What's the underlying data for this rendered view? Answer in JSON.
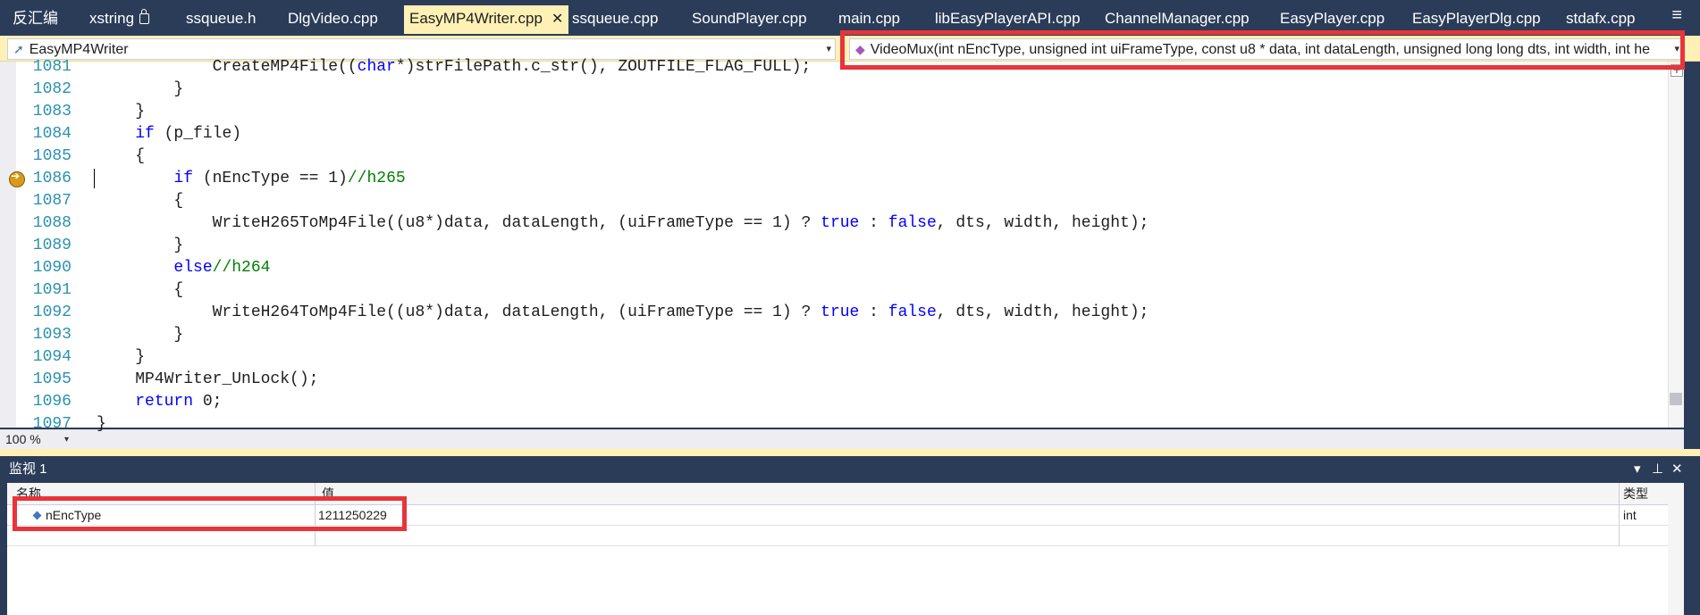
{
  "tabs": [
    {
      "label": "反汇编",
      "active": false
    },
    {
      "label": "xstring",
      "active": false,
      "locked": true
    },
    {
      "label": "ssqueue.h",
      "active": false
    },
    {
      "label": "DlgVideo.cpp",
      "active": false
    },
    {
      "label": "EasyMP4Writer.cpp",
      "active": true,
      "close": "✕"
    },
    {
      "label": "ssqueue.cpp",
      "active": false
    },
    {
      "label": "SoundPlayer.cpp",
      "active": false
    },
    {
      "label": "main.cpp",
      "active": false
    },
    {
      "label": "libEasyPlayerAPI.cpp",
      "active": false
    },
    {
      "label": "ChannelManager.cpp",
      "active": false
    },
    {
      "label": "EasyPlayer.cpp",
      "active": false
    },
    {
      "label": "EasyPlayerDlg.cpp",
      "active": false
    },
    {
      "label": "stdafx.cpp",
      "active": false
    }
  ],
  "nav": {
    "scope": "EasyMP4Writer",
    "member": "VideoMux(int nEncType, unsigned int uiFrameType, const u8 * data, int dataLength, unsigned long long dts, int width, int he"
  },
  "code_lines": [
    {
      "num": "1081",
      "segs": [
        {
          "t": "            CreateMP4File(("
        },
        {
          "t": "char",
          "c": "kw"
        },
        {
          "t": "*)strFilePath.c_str(), ZOUTFILE_FLAG_FULL);"
        }
      ]
    },
    {
      "num": "1082",
      "segs": [
        {
          "t": "        }"
        }
      ]
    },
    {
      "num": "1083",
      "segs": [
        {
          "t": "    }"
        }
      ]
    },
    {
      "num": "1084",
      "segs": [
        {
          "t": "    "
        },
        {
          "t": "if",
          "c": "kw"
        },
        {
          "t": " (p_file)"
        }
      ]
    },
    {
      "num": "1085",
      "segs": [
        {
          "t": "    {"
        }
      ]
    },
    {
      "num": "1086",
      "segs": [
        {
          "t": "        "
        },
        {
          "t": "if",
          "c": "kw"
        },
        {
          "t": " (nEncType == 1)"
        },
        {
          "t": "//h265",
          "c": "cm"
        }
      ]
    },
    {
      "num": "1087",
      "segs": [
        {
          "t": "        {"
        }
      ]
    },
    {
      "num": "1088",
      "segs": [
        {
          "t": "            WriteH265ToMp4File((u8*)data, dataLength, (uiFrameType == 1) ? "
        },
        {
          "t": "true",
          "c": "kw"
        },
        {
          "t": " : "
        },
        {
          "t": "false",
          "c": "kw"
        },
        {
          "t": ", dts, width, height);"
        }
      ]
    },
    {
      "num": "1089",
      "segs": [
        {
          "t": "        }"
        }
      ]
    },
    {
      "num": "1090",
      "segs": [
        {
          "t": "        "
        },
        {
          "t": "else",
          "c": "kw"
        },
        {
          "t": "//h264",
          "c": "cm"
        }
      ]
    },
    {
      "num": "1091",
      "segs": [
        {
          "t": "        {"
        }
      ]
    },
    {
      "num": "1092",
      "segs": [
        {
          "t": "            WriteH264ToMp4File((u8*)data, dataLength, (uiFrameType == 1) ? "
        },
        {
          "t": "true",
          "c": "kw"
        },
        {
          "t": " : "
        },
        {
          "t": "false",
          "c": "kw"
        },
        {
          "t": ", dts, width, height);"
        }
      ]
    },
    {
      "num": "1093",
      "segs": [
        {
          "t": "        }"
        }
      ]
    },
    {
      "num": "1094",
      "segs": [
        {
          "t": "    }"
        }
      ]
    },
    {
      "num": "1095",
      "segs": [
        {
          "t": "    MP4Writer_UnLock();"
        }
      ]
    },
    {
      "num": "1096",
      "segs": [
        {
          "t": "    "
        },
        {
          "t": "return",
          "c": "kw"
        },
        {
          "t": " 0;"
        }
      ]
    },
    {
      "num": "1097",
      "segs": [
        {
          "t": "}"
        }
      ]
    }
  ],
  "editor": {
    "zoom": "100 %",
    "current_line": "1086",
    "plus_glyph": "+"
  },
  "watch": {
    "title": "监视 1",
    "headers": {
      "name": "名称",
      "value": "值",
      "type": "类型"
    },
    "rows": [
      {
        "name": "nEncType",
        "value": "1211250229",
        "type": "int"
      }
    ],
    "buttons": {
      "dropdown": "▾",
      "pin": "⊥",
      "close": "✕"
    }
  },
  "icons": {
    "menu": "≡"
  },
  "colors": {
    "chrome": "#2b3c59",
    "active_tab": "#fff1b5",
    "keyword": "#0000ff",
    "comment": "#008000",
    "line_number": "#2b91af",
    "highlight": "#e8343a"
  }
}
